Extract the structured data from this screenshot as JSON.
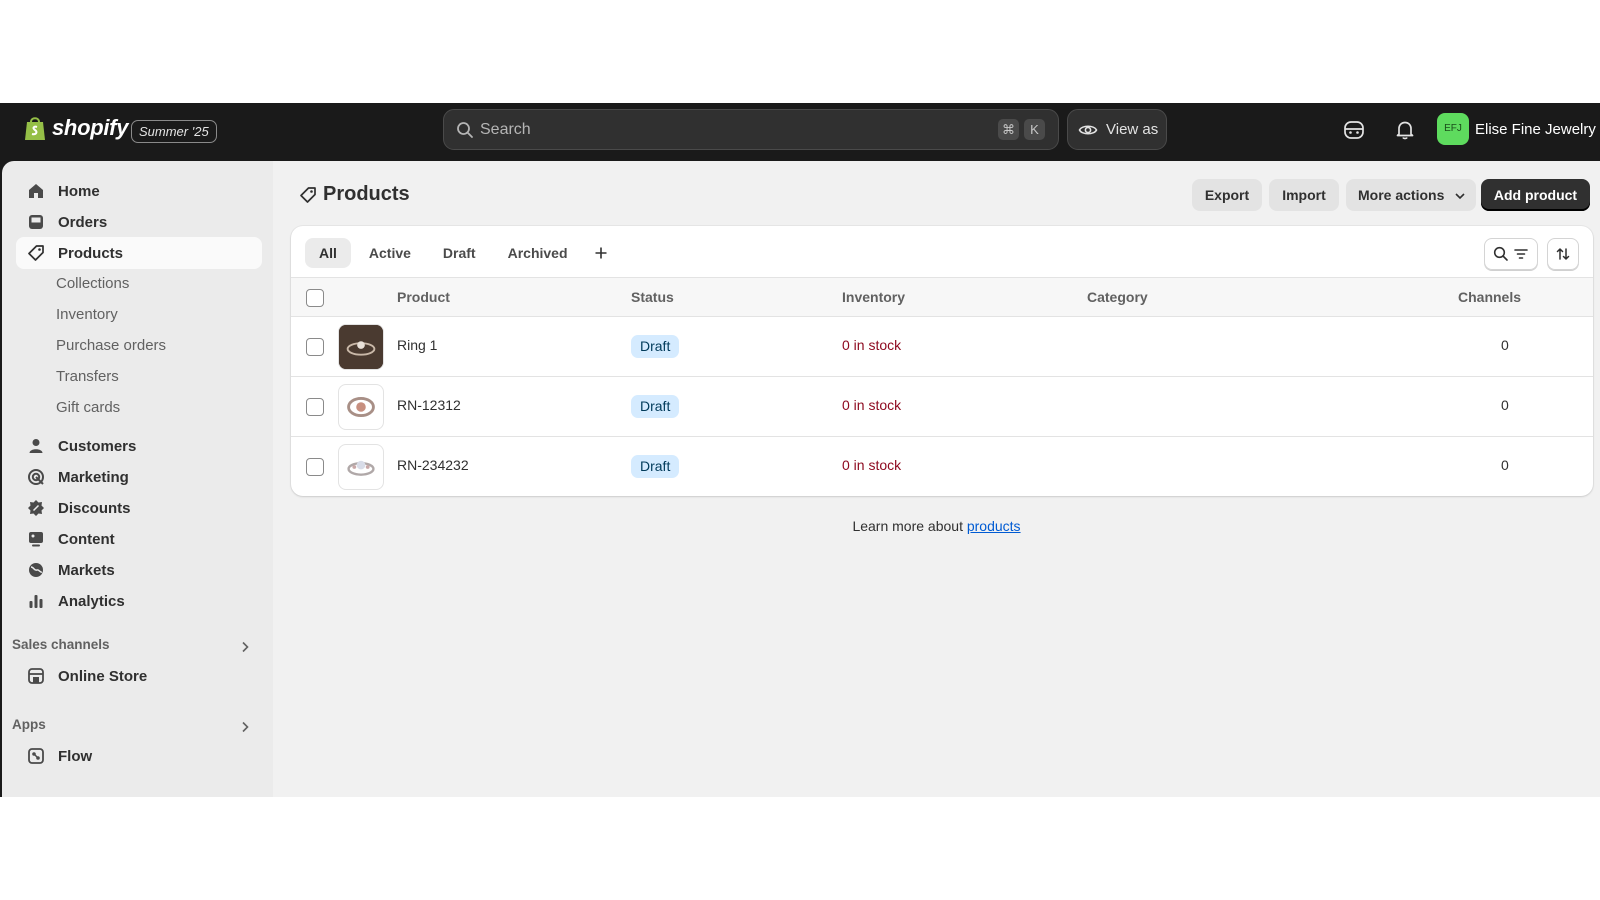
{
  "brand": {
    "wordmark": "shopify",
    "release_badge": "Summer '25",
    "bag_color": "#95bf47"
  },
  "search": {
    "placeholder": "Search",
    "shortcut_cmd": "⌘",
    "shortcut_key": "K"
  },
  "topbar": {
    "view_as_label": "View as",
    "store_initials": "EFJ",
    "store_name": "Elise Fine Jewelry",
    "avatar_color": "#5edb5e"
  },
  "sidebar": {
    "items": [
      {
        "label": "Home",
        "icon": "home-icon"
      },
      {
        "label": "Orders",
        "icon": "inbox-icon"
      },
      {
        "label": "Products",
        "icon": "tag-icon",
        "active": true
      },
      {
        "label": "Customers",
        "icon": "person-icon"
      },
      {
        "label": "Marketing",
        "icon": "target-icon"
      },
      {
        "label": "Discounts",
        "icon": "discount-icon"
      },
      {
        "label": "Content",
        "icon": "image-icon"
      },
      {
        "label": "Markets",
        "icon": "globe-icon"
      },
      {
        "label": "Analytics",
        "icon": "bar-chart-icon"
      }
    ],
    "product_subitems": [
      "Collections",
      "Inventory",
      "Purchase orders",
      "Transfers",
      "Gift cards"
    ],
    "sales_channels": {
      "title": "Sales channels",
      "items": [
        {
          "label": "Online Store",
          "icon": "store-icon"
        }
      ]
    },
    "apps": {
      "title": "Apps",
      "items": [
        {
          "label": "Flow",
          "icon": "flow-icon"
        }
      ]
    }
  },
  "page": {
    "title": "Products",
    "actions": {
      "export": "Export",
      "import": "Import",
      "more_actions": "More actions",
      "add_product": "Add product"
    },
    "tabs": [
      "All",
      "Active",
      "Draft",
      "Archived"
    ],
    "columns": {
      "product": "Product",
      "status": "Status",
      "inventory": "Inventory",
      "category": "Category",
      "channels": "Channels"
    },
    "rows": [
      {
        "name": "Ring 1",
        "status": "Draft",
        "inventory": "0 in stock",
        "category": "",
        "channels": "0"
      },
      {
        "name": "RN-12312",
        "status": "Draft",
        "inventory": "0 in stock",
        "category": "",
        "channels": "0"
      },
      {
        "name": "RN-234232",
        "status": "Draft",
        "inventory": "0 in stock",
        "category": "",
        "channels": "0"
      }
    ],
    "learn_more_text": "Learn more about",
    "learn_more_link": "products"
  },
  "colors": {
    "topbar": "#1a1a1a",
    "sidebar": "#ebebeb",
    "main": "#f1f1f1",
    "badge_draft": "#d5ebff",
    "stock_critical": "#8e0b21",
    "link": "#005bd3"
  }
}
